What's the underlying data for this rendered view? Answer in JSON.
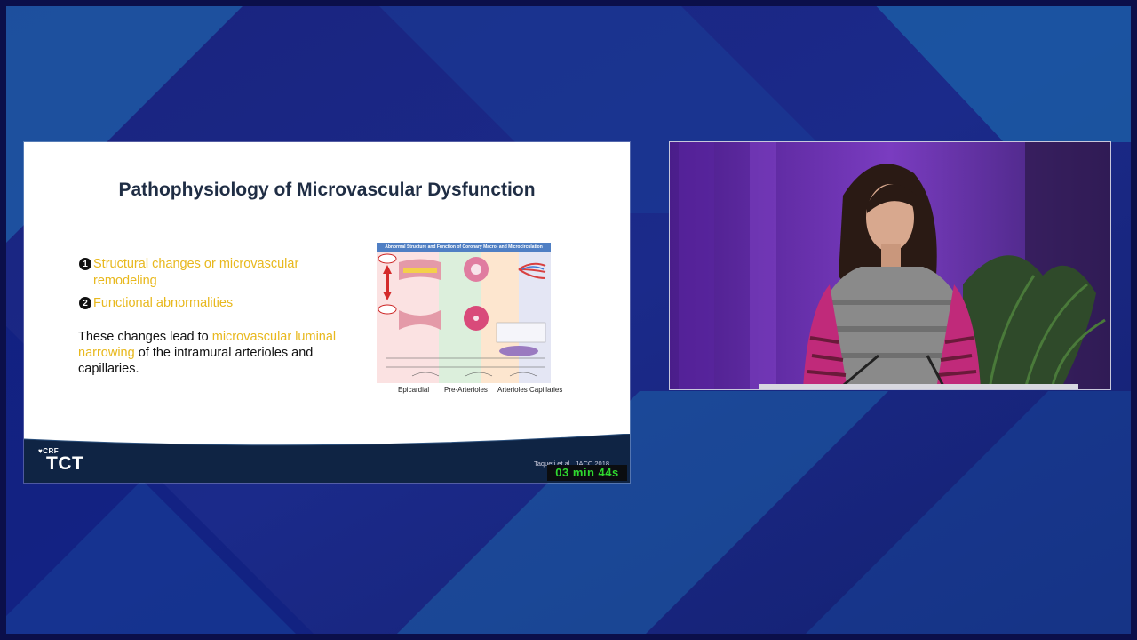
{
  "slide": {
    "title": "Pathophysiology of Microvascular Dysfunction",
    "bullets": [
      {
        "number": "1",
        "text": "Structural changes or microvascular remodeling"
      },
      {
        "number": "2",
        "text": "Functional abnormalities"
      }
    ],
    "description": {
      "before": "These changes lead to ",
      "highlight": "microvascular luminal narrowing",
      "after": " of the intramural arterioles and capillaries."
    },
    "figure": {
      "caption": "Abnormal Structure and Function of Coronary Macro- and Microcirculation",
      "labels": [
        "Epicardial",
        "Pre-Arterioles",
        "Arterioles Capillaries"
      ]
    },
    "citation": "Taqueti et al., JACC 2018",
    "logo": {
      "org": "CRF",
      "brand": "TCT"
    }
  },
  "timer": {
    "text": "03 min 44s"
  },
  "colors": {
    "background": "#16207a",
    "accent_yellow": "#e8b81d",
    "title_color": "#1f2d44",
    "footer_navy": "#0f2444",
    "timer_green": "#2fd82f"
  },
  "video": {
    "subject": "speaker-at-podium"
  }
}
